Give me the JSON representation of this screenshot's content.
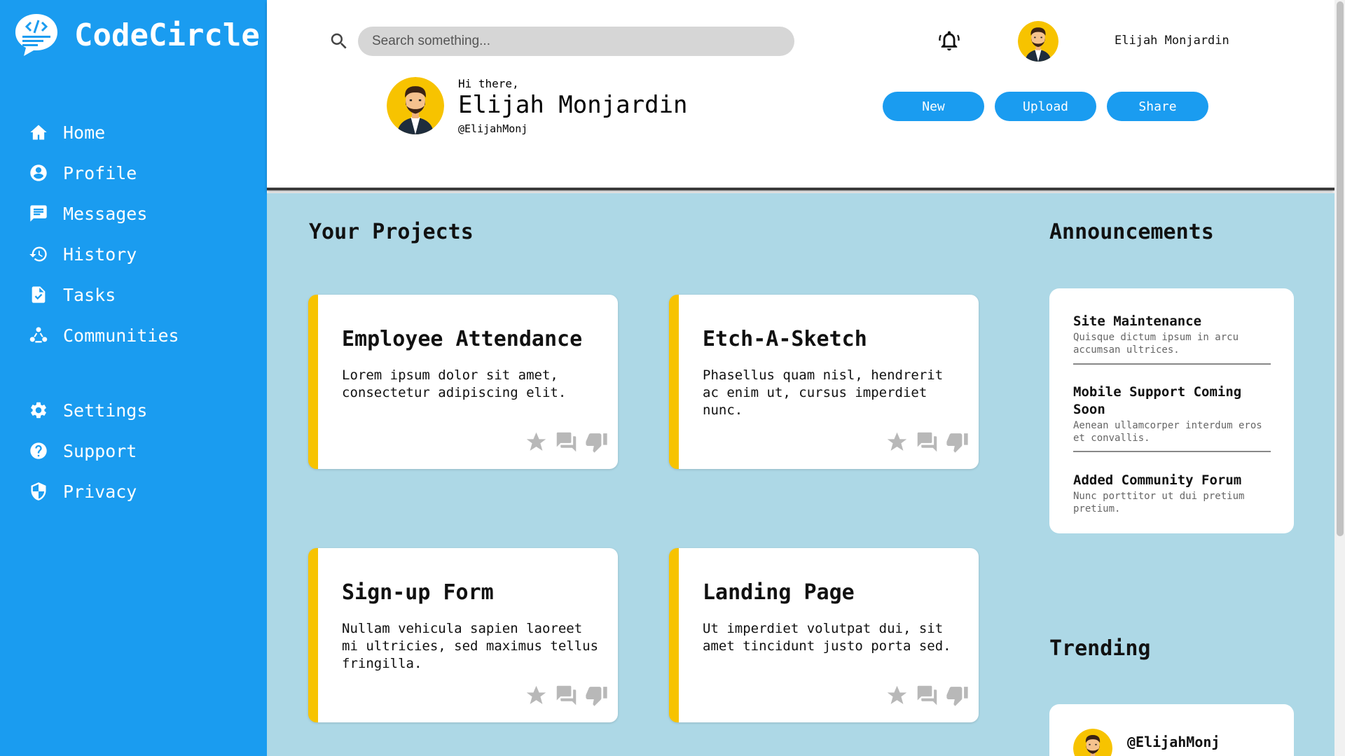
{
  "app": {
    "name": "CodeCircle",
    "logo_icon": "code-chat-logo-icon"
  },
  "sidebar": {
    "primary": [
      {
        "label": "Home",
        "icon": "home-icon"
      },
      {
        "label": "Profile",
        "icon": "account-circle-icon"
      },
      {
        "label": "Messages",
        "icon": "message-icon"
      },
      {
        "label": "History",
        "icon": "history-icon"
      },
      {
        "label": "Tasks",
        "icon": "task-icon"
      },
      {
        "label": "Communities",
        "icon": "communities-icon"
      }
    ],
    "secondary": [
      {
        "label": "Settings",
        "icon": "gear-icon"
      },
      {
        "label": "Support",
        "icon": "help-icon"
      },
      {
        "label": "Privacy",
        "icon": "shield-icon"
      }
    ]
  },
  "header": {
    "search_placeholder": "Search something...",
    "username": "Elijah Monjardin",
    "greeting": "Hi there,",
    "name": "Elijah Monjardin",
    "handle": "@ElijahMonj",
    "buttons": {
      "new": "New",
      "upload": "Upload",
      "share": "Share"
    }
  },
  "projects": {
    "title": "Your Projects",
    "items": [
      {
        "title": "Employee Attendance",
        "desc": "Lorem ipsum dolor sit amet, consectetur adipiscing elit."
      },
      {
        "title": "Etch-A-Sketch",
        "desc": "Phasellus quam nisl, hendrerit ac enim ut, cursus imperdiet nunc."
      },
      {
        "title": "Sign-up Form",
        "desc": "Nullam vehicula sapien laoreet mi ultricies, sed maximus tellus fringilla."
      },
      {
        "title": "Landing Page",
        "desc": "Ut imperdiet volutpat dui, sit amet tincidunt justo porta sed."
      }
    ]
  },
  "announcements": {
    "title": "Announcements",
    "items": [
      {
        "title": "Site Maintenance",
        "desc": "Quisque dictum ipsum in arcu accumsan ultrices."
      },
      {
        "title": "Mobile Support Coming Soon",
        "desc": "Aenean ullamcorper interdum eros et convallis."
      },
      {
        "title": "Added Community Forum",
        "desc": "Nunc porttitor ut dui pretium pretium."
      }
    ]
  },
  "trending": {
    "title": "Trending",
    "items": [
      {
        "handle": "@ElijahMonj"
      }
    ]
  },
  "colors": {
    "primary": "#1a9cf0",
    "main_bg": "#add8e6",
    "accent": "#f7c300",
    "action_icon": "#b8b8b8"
  }
}
